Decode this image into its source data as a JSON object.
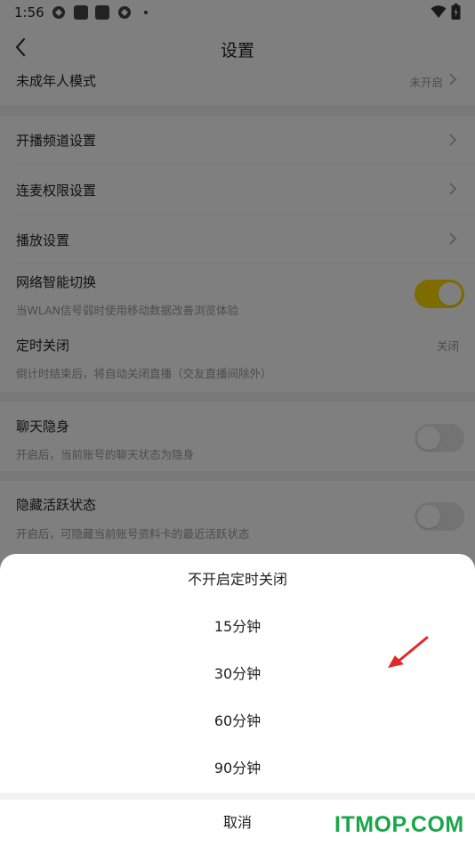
{
  "statusbar": {
    "time": "1:56"
  },
  "header": {
    "title": "设置"
  },
  "rows": {
    "minor_mode": {
      "title": "未成年人模式",
      "value": "未开启"
    },
    "channel": {
      "title": "开播频道设置"
    },
    "mic_link": {
      "title": "连麦权限设置"
    },
    "playback": {
      "title": "播放设置"
    },
    "network": {
      "title": "网络智能切换",
      "subtitle": "当WLAN信号弱时使用移动数据改善浏览体验",
      "enabled": true
    },
    "timer": {
      "title": "定时关闭",
      "subtitle": "倒计时结束后，将自动关闭直播（交友直播间除外）",
      "value": "关闭"
    },
    "chat_invisible": {
      "title": "聊天隐身",
      "subtitle": "开启后，当前账号的聊天状态为隐身",
      "enabled": false
    },
    "hide_active": {
      "title": "隐藏活跃状态",
      "subtitle": "开启后，可隐藏当前账号资料卡的最近活跃状态",
      "enabled": false
    }
  },
  "sheet": {
    "options": [
      "不开启定时关闭",
      "15分钟",
      "30分钟",
      "60分钟",
      "90分钟"
    ],
    "cancel": "取消"
  },
  "watermark": "ITMOP.COM",
  "colors": {
    "toggle_on": "#ffd800",
    "watermark": "#1aa64a",
    "arrow": "#e02a2a"
  }
}
